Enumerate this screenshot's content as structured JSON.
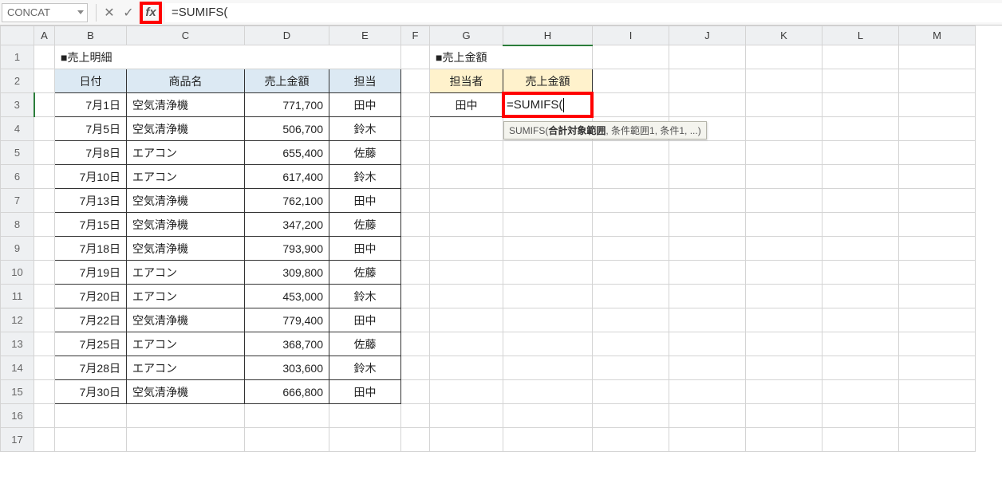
{
  "formula_bar": {
    "name_box": "CONCAT",
    "cancel_glyph": "✕",
    "enter_glyph": "✓",
    "fx_label": "fx",
    "formula_text": "=SUMIFS("
  },
  "columns": [
    "A",
    "B",
    "C",
    "D",
    "E",
    "F",
    "G",
    "H",
    "I",
    "J",
    "K",
    "L",
    "M"
  ],
  "row_numbers": [
    "1",
    "2",
    "3",
    "4",
    "5",
    "6",
    "7",
    "8",
    "9",
    "10",
    "11",
    "12",
    "13",
    "14",
    "15",
    "16",
    "17"
  ],
  "sales_detail": {
    "title": "■売上明細",
    "headers": {
      "date": "日付",
      "product": "商品名",
      "amount": "売上金額",
      "person": "担当"
    },
    "rows": [
      {
        "date": "7月1日",
        "product": "空気清浄機",
        "amount": "771,700",
        "person": "田中"
      },
      {
        "date": "7月5日",
        "product": "空気清浄機",
        "amount": "506,700",
        "person": "鈴木"
      },
      {
        "date": "7月8日",
        "product": "エアコン",
        "amount": "655,400",
        "person": "佐藤"
      },
      {
        "date": "7月10日",
        "product": "エアコン",
        "amount": "617,400",
        "person": "鈴木"
      },
      {
        "date": "7月13日",
        "product": "空気清浄機",
        "amount": "762,100",
        "person": "田中"
      },
      {
        "date": "7月15日",
        "product": "空気清浄機",
        "amount": "347,200",
        "person": "佐藤"
      },
      {
        "date": "7月18日",
        "product": "空気清浄機",
        "amount": "793,900",
        "person": "田中"
      },
      {
        "date": "7月19日",
        "product": "エアコン",
        "amount": "309,800",
        "person": "佐藤"
      },
      {
        "date": "7月20日",
        "product": "エアコン",
        "amount": "453,000",
        "person": "鈴木"
      },
      {
        "date": "7月22日",
        "product": "空気清浄機",
        "amount": "779,400",
        "person": "田中"
      },
      {
        "date": "7月25日",
        "product": "エアコン",
        "amount": "368,700",
        "person": "佐藤"
      },
      {
        "date": "7月28日",
        "product": "エアコン",
        "amount": "303,600",
        "person": "鈴木"
      },
      {
        "date": "7月30日",
        "product": "空気清浄機",
        "amount": "666,800",
        "person": "田中"
      }
    ]
  },
  "sales_amount": {
    "title": "■売上金額",
    "headers": {
      "person": "担当者",
      "amount": "売上金額"
    },
    "rows": [
      {
        "person": "田中",
        "formula": "=SUMIFS("
      }
    ]
  },
  "tooltip": {
    "fn": "SUMIFS",
    "arg_bold": "合計対象範囲",
    "rest": ", 条件範囲1, 条件1, ...)"
  },
  "active": {
    "col": "H",
    "row": "3"
  }
}
